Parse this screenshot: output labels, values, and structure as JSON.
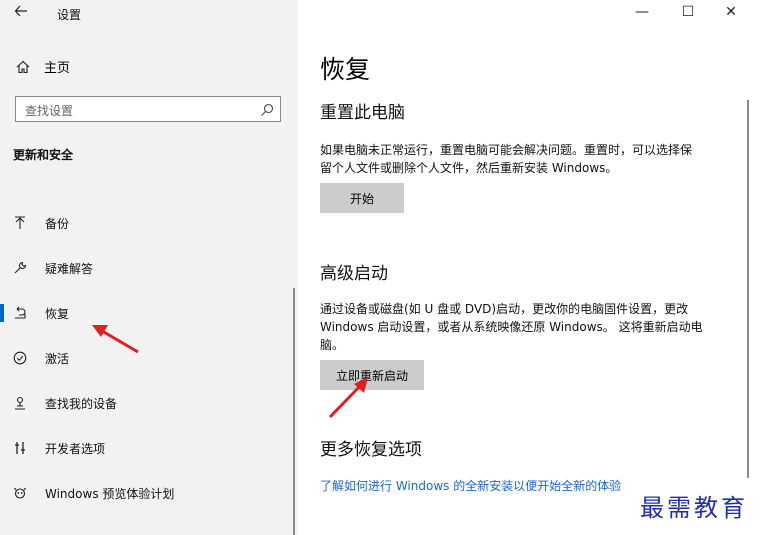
{
  "app": {
    "title": "设置"
  },
  "sidebar": {
    "home_label": "主页",
    "search_placeholder": "查找设置",
    "section_title": "更新和安全",
    "items": [
      {
        "label": "备份",
        "icon": "backup-arrow-icon"
      },
      {
        "label": "疑难解答",
        "icon": "wrench-icon"
      },
      {
        "label": "恢复",
        "icon": "recovery-icon",
        "selected": true
      },
      {
        "label": "激活",
        "icon": "activation-check-icon"
      },
      {
        "label": "查找我的设备",
        "icon": "find-device-icon"
      },
      {
        "label": "开发者选项",
        "icon": "developer-options-icon"
      },
      {
        "label": "Windows 预览体验计划",
        "icon": "insider-icon"
      }
    ]
  },
  "window_controls": {
    "minimize": "—",
    "maximize": "☐",
    "close": "✕"
  },
  "main": {
    "title": "恢复",
    "reset": {
      "heading": "重置此电脑",
      "line1": "如果电脑未正常运行，重置电脑可能会解决问题。重置时，可以选择保",
      "line2": "留个人文件或删除个人文件，然后重新安装 Windows。",
      "button": "开始"
    },
    "advanced": {
      "heading": "高级启动",
      "line1": "通过设备或磁盘(如 U 盘或 DVD)启动，更改你的电脑固件设置，更改",
      "line2": "Windows 启动设置，或者从系统映像还原 Windows。  这将重新启动电",
      "line3": "脑。",
      "button": "立即重新启动"
    },
    "more": {
      "heading": "更多恢复选项",
      "link": "了解如何进行 Windows 的全新安装以便开始全新的体验"
    }
  },
  "watermark": "最需教育",
  "colors": {
    "accent": "#0067c0",
    "annotation_arrow": "#e02020",
    "link": "#1a66d1",
    "watermark": "#1f2fa6"
  }
}
